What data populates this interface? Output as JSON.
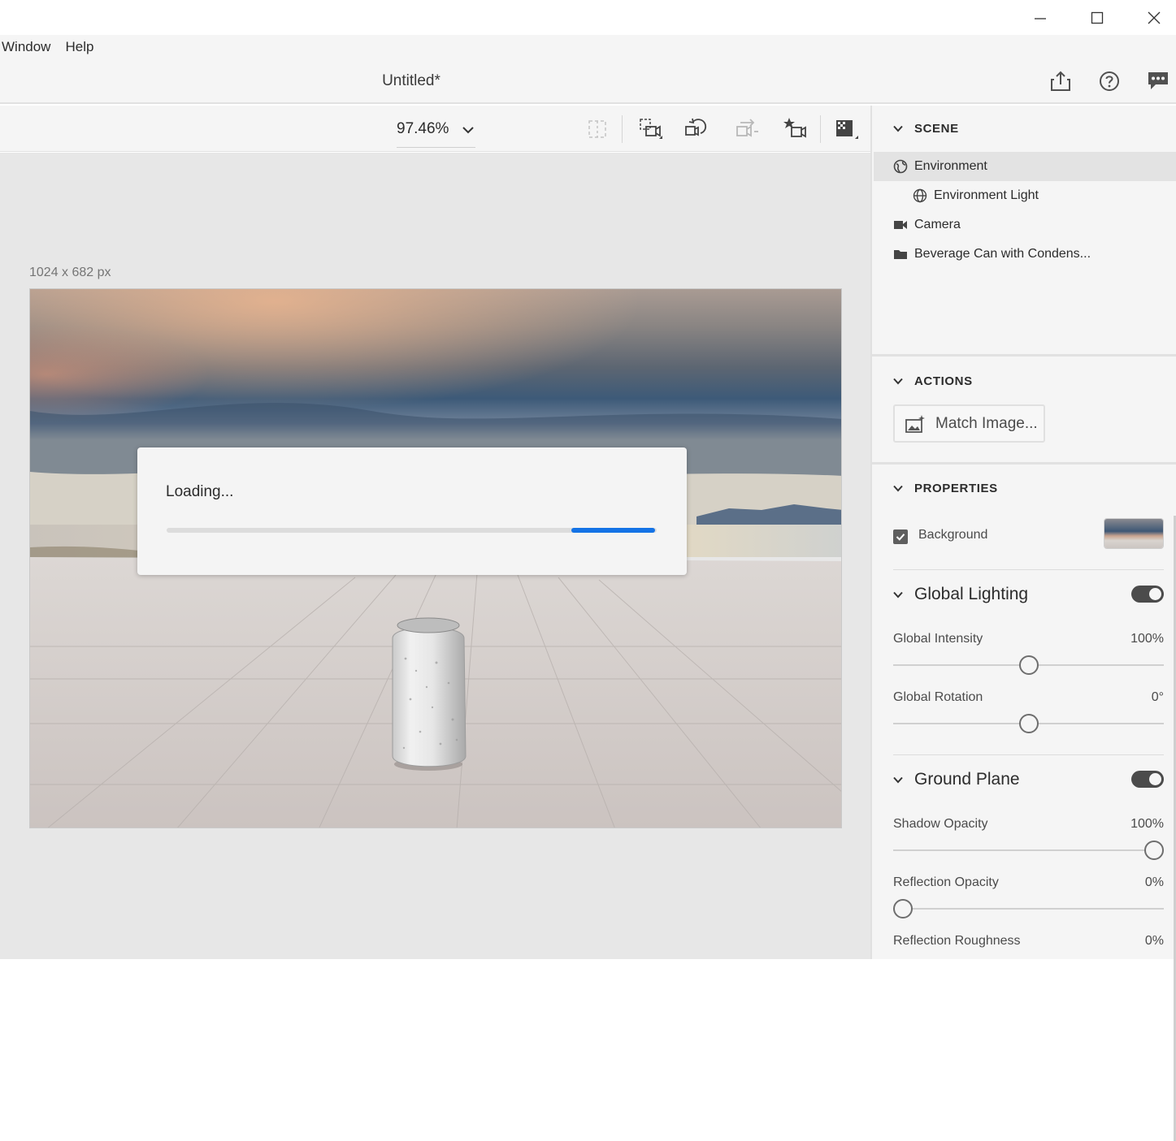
{
  "window": {
    "minimize_icon": "minimize-icon",
    "maximize_icon": "maximize-icon",
    "close_icon": "close-icon"
  },
  "menubar": {
    "items": [
      "Window",
      "Help"
    ]
  },
  "header": {
    "title": "Untitled*",
    "icons": [
      "share-icon",
      "help-icon",
      "feedback-icon"
    ]
  },
  "toolbar": {
    "zoom": "97.46%",
    "icons": [
      "select-region-icon",
      "camera-frame-icon",
      "camera-orbit-icon",
      "camera-pan-icon",
      "camera-bookmark-icon",
      "render-preview-icon"
    ]
  },
  "canvas": {
    "size_label": "1024 x 682 px"
  },
  "loading": {
    "text": "Loading...",
    "progress": 0.17,
    "accent": "#1473e6"
  },
  "panel": {
    "scene": {
      "title": "SCENE",
      "items": [
        {
          "label": "Environment",
          "icon": "environment-icon",
          "selected": true
        },
        {
          "label": "Environment Light",
          "icon": "globe-icon",
          "selected": false
        },
        {
          "label": "Camera",
          "icon": "camera-icon",
          "selected": false
        },
        {
          "label": "Beverage Can with Condens...",
          "icon": "folder-icon",
          "selected": false
        }
      ]
    },
    "actions": {
      "title": "ACTIONS",
      "match_image": "Match Image..."
    },
    "properties": {
      "title": "PROPERTIES",
      "background": {
        "label": "Background",
        "checked": true
      },
      "global_lighting": {
        "title": "Global Lighting",
        "enabled": true,
        "intensity": {
          "label": "Global Intensity",
          "value": "100%",
          "fraction": 0.5
        },
        "rotation": {
          "label": "Global Rotation",
          "value": "0°",
          "fraction": 0.5
        }
      },
      "ground_plane": {
        "title": "Ground Plane",
        "enabled": true,
        "shadow_opacity": {
          "label": "Shadow Opacity",
          "value": "100%",
          "fraction": 1.0
        },
        "reflection_opacity": {
          "label": "Reflection Opacity",
          "value": "0%",
          "fraction": 0.0
        },
        "reflection_roughness": {
          "label": "Reflection Roughness",
          "value": "0%",
          "fraction": 0.0
        }
      }
    }
  }
}
